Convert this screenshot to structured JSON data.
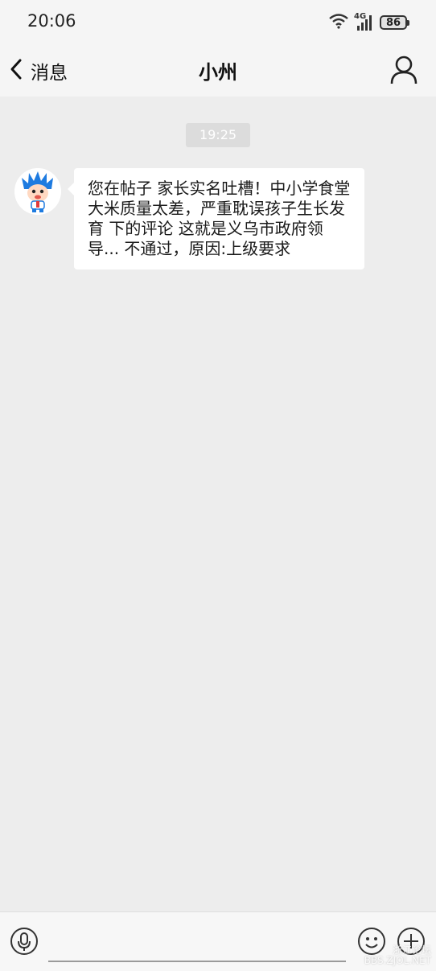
{
  "status_bar": {
    "time": "20:06",
    "network": "4G",
    "battery": "86"
  },
  "nav": {
    "back_label": "消息",
    "title": "小州"
  },
  "chat": {
    "timestamp": "19:25",
    "messages": [
      {
        "sender": "incoming",
        "text": "您在帖子 家长实名吐槽！中小学食堂大米质量太差，严重耽误孩子生长发育 下的评论 这就是义乌市政府领导... 不通过，原因:上级要求"
      }
    ]
  },
  "input_bar": {
    "placeholder": ""
  },
  "watermark": {
    "line1": "浙江论坛",
    "line2": "BBS.ZJOL.NET"
  },
  "colors": {
    "background": "#ededed",
    "bubble": "#ffffff",
    "bars": "#f5f5f5",
    "avatar_accent": "#1e7be0"
  },
  "icons": [
    "wifi-icon",
    "signal-icon",
    "battery-icon",
    "back-chevron-icon",
    "person-icon",
    "microphone-icon",
    "emoji-icon",
    "plus-icon"
  ]
}
